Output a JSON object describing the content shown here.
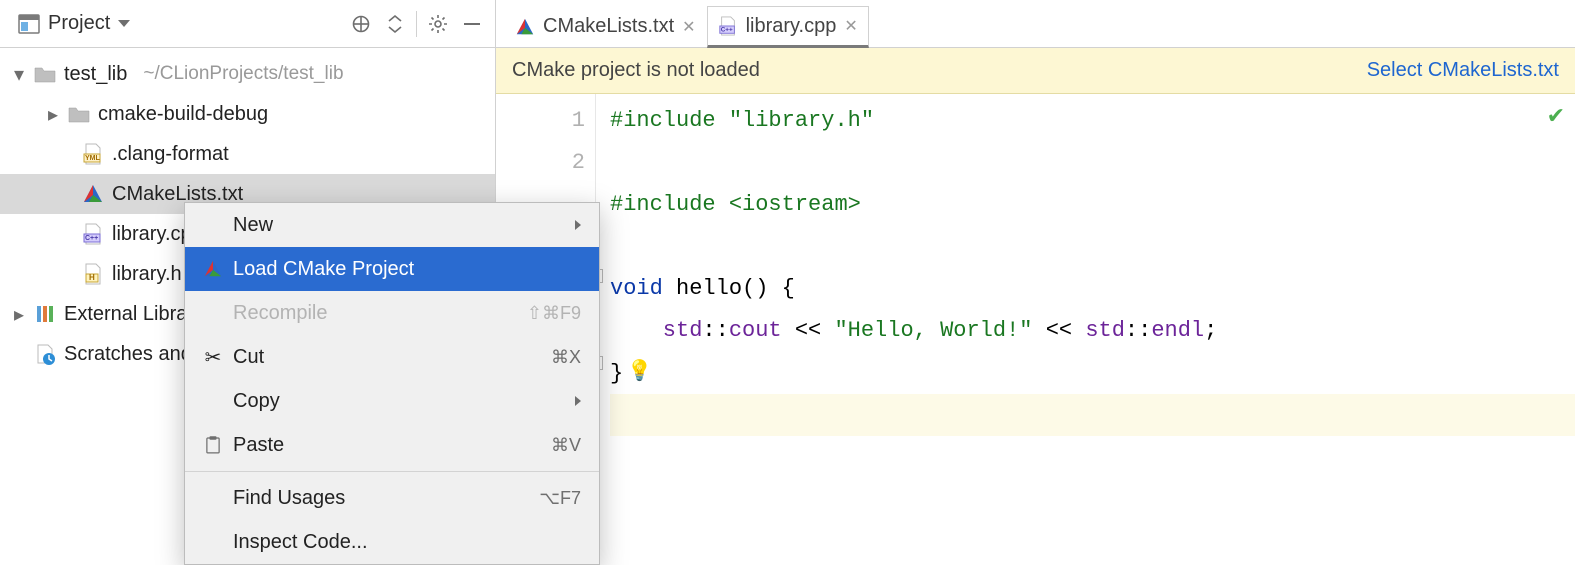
{
  "sidebar": {
    "title": "Project",
    "root": {
      "name": "test_lib",
      "path": "~/CLionProjects/test_lib",
      "children": [
        {
          "name": "cmake-build-debug",
          "type": "folder"
        },
        {
          "name": ".clang-format",
          "type": "yml"
        },
        {
          "name": "CMakeLists.txt",
          "type": "cmake",
          "selected": true
        },
        {
          "name": "library.cpp",
          "type": "cpp"
        },
        {
          "name": "library.h",
          "type": "h"
        }
      ]
    },
    "external_label": "External Libraries",
    "scratches_label": "Scratches and Consoles"
  },
  "context_menu": {
    "items": [
      {
        "label": "New",
        "submenu": true
      },
      {
        "label": "Load CMake Project",
        "icon": "cmake",
        "selected": true
      },
      {
        "label": "Recompile",
        "shortcut": "⇧⌘F9",
        "disabled": true
      },
      {
        "label": "Cut",
        "shortcut": "⌘X",
        "icon": "scissors"
      },
      {
        "label": "Copy",
        "submenu": true
      },
      {
        "label": "Paste",
        "shortcut": "⌘V",
        "icon": "clipboard"
      },
      {
        "label": "Find Usages",
        "shortcut": "⌥F7"
      },
      {
        "label": "Inspect Code..."
      }
    ]
  },
  "tabs": [
    {
      "label": "CMakeLists.txt",
      "icon": "cmake"
    },
    {
      "label": "library.cpp",
      "icon": "cpp",
      "active": true
    }
  ],
  "banner": {
    "message": "CMake project is not loaded",
    "action": "Select CMakeLists.txt"
  },
  "gutter_lines": [
    "1",
    "2"
  ],
  "code": {
    "l1_a": "#include ",
    "l1_b": "\"library.h\"",
    "l3_a": "#include ",
    "l3_b": "<",
    "l3_c": "iostream",
    "l3_d": ">",
    "l5_a": "void ",
    "l5_b": "hello",
    "l5_c": "() {",
    "l6_a": "    std",
    "l6_b": "::",
    "l6_c": "cout",
    "l6_d": " << ",
    "l6_e": "\"Hello, World!\"",
    "l6_f": " << ",
    "l6_g": "std",
    "l6_h": "::",
    "l6_i": "endl",
    "l6_j": ";",
    "l7": "}"
  }
}
